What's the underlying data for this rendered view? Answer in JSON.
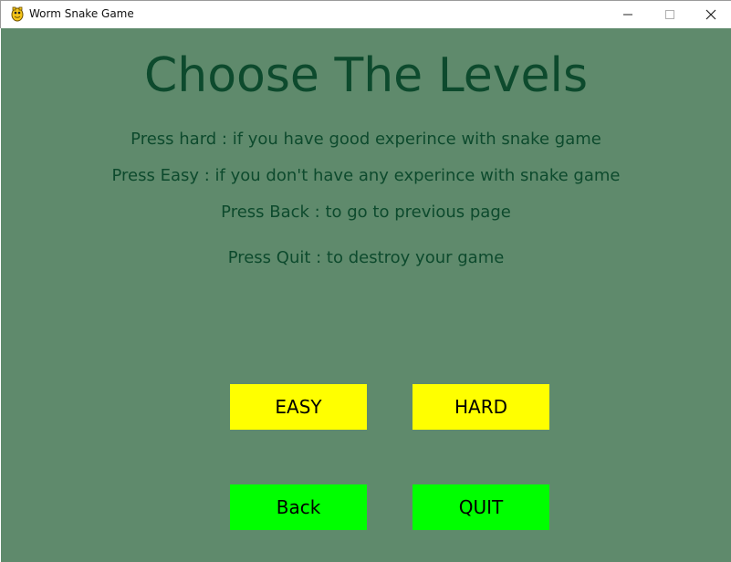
{
  "window": {
    "title": "Worm Snake Game",
    "icon": "snake-app-icon",
    "controls": [
      "minimize-icon",
      "maximize-icon",
      "close-icon"
    ]
  },
  "screen": {
    "title": "Choose The Levels",
    "instructions": [
      "Press hard : if you have good experince with snake game",
      "Press Easy : if you  don't have any  experince with snake game",
      "Press Back : to go to previous page",
      "Press Quit : to destroy your game"
    ],
    "buttons": {
      "easy": "EASY",
      "hard": "HARD",
      "back": "Back",
      "quit": "QUIT"
    }
  },
  "colors": {
    "background": "#5f8a6c",
    "text": "#0d4a2d",
    "level_buttons": "#ffff00",
    "nav_buttons": "#00ff00"
  }
}
